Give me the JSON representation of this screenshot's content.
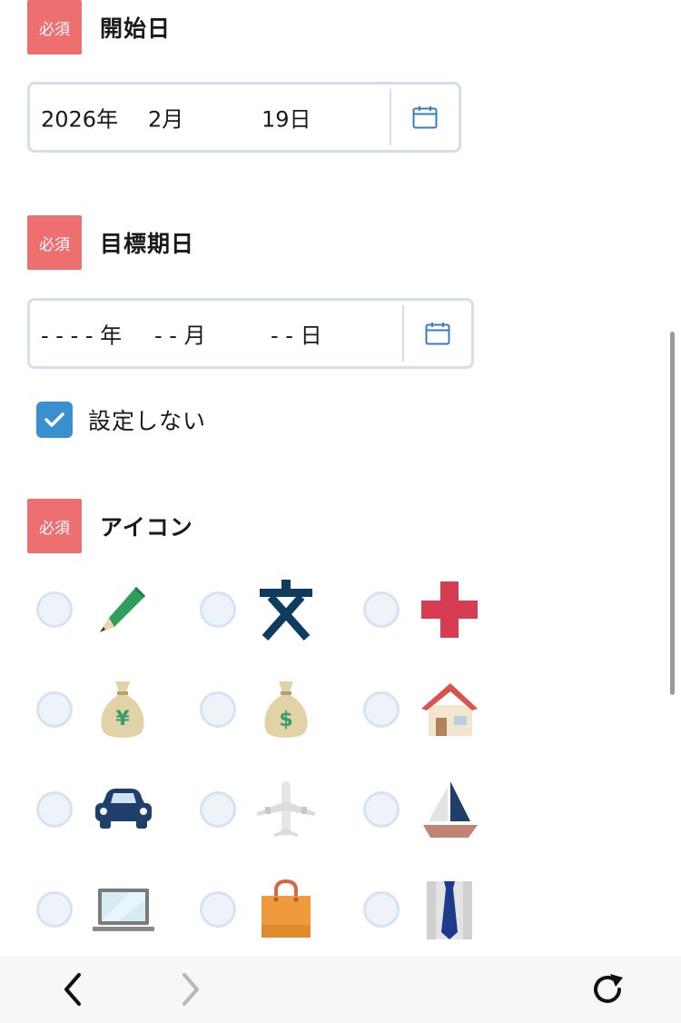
{
  "required_badge": "必須",
  "start_date": {
    "title": "開始日",
    "year": "2026年",
    "month": "2月",
    "day": "19日"
  },
  "target_date": {
    "title": "目標期日",
    "year": "- - - - 年",
    "month": "- - 月",
    "day": "- - 日",
    "no_setting_label": "設定しない",
    "no_setting_checked": true
  },
  "icon_field": {
    "title": "アイコン",
    "options": [
      {
        "icon": "pencil-icon"
      },
      {
        "icon": "text-character-icon"
      },
      {
        "icon": "red-cross-icon"
      },
      {
        "icon": "yen-money-bag-icon"
      },
      {
        "icon": "dollar-money-bag-icon"
      },
      {
        "icon": "house-icon"
      },
      {
        "icon": "car-icon"
      },
      {
        "icon": "airplane-icon"
      },
      {
        "icon": "sailboat-icon"
      },
      {
        "icon": "laptop-icon"
      },
      {
        "icon": "shopping-bag-icon"
      },
      {
        "icon": "shirt-tie-icon"
      }
    ]
  },
  "colors": {
    "required_badge": "#ee6f6f",
    "checkbox": "#3a8fcf",
    "input_border": "#d3dff0"
  },
  "bottom_bar": {
    "back": "chevron-left-icon",
    "forward": "chevron-right-icon",
    "reload": "reload-icon"
  }
}
